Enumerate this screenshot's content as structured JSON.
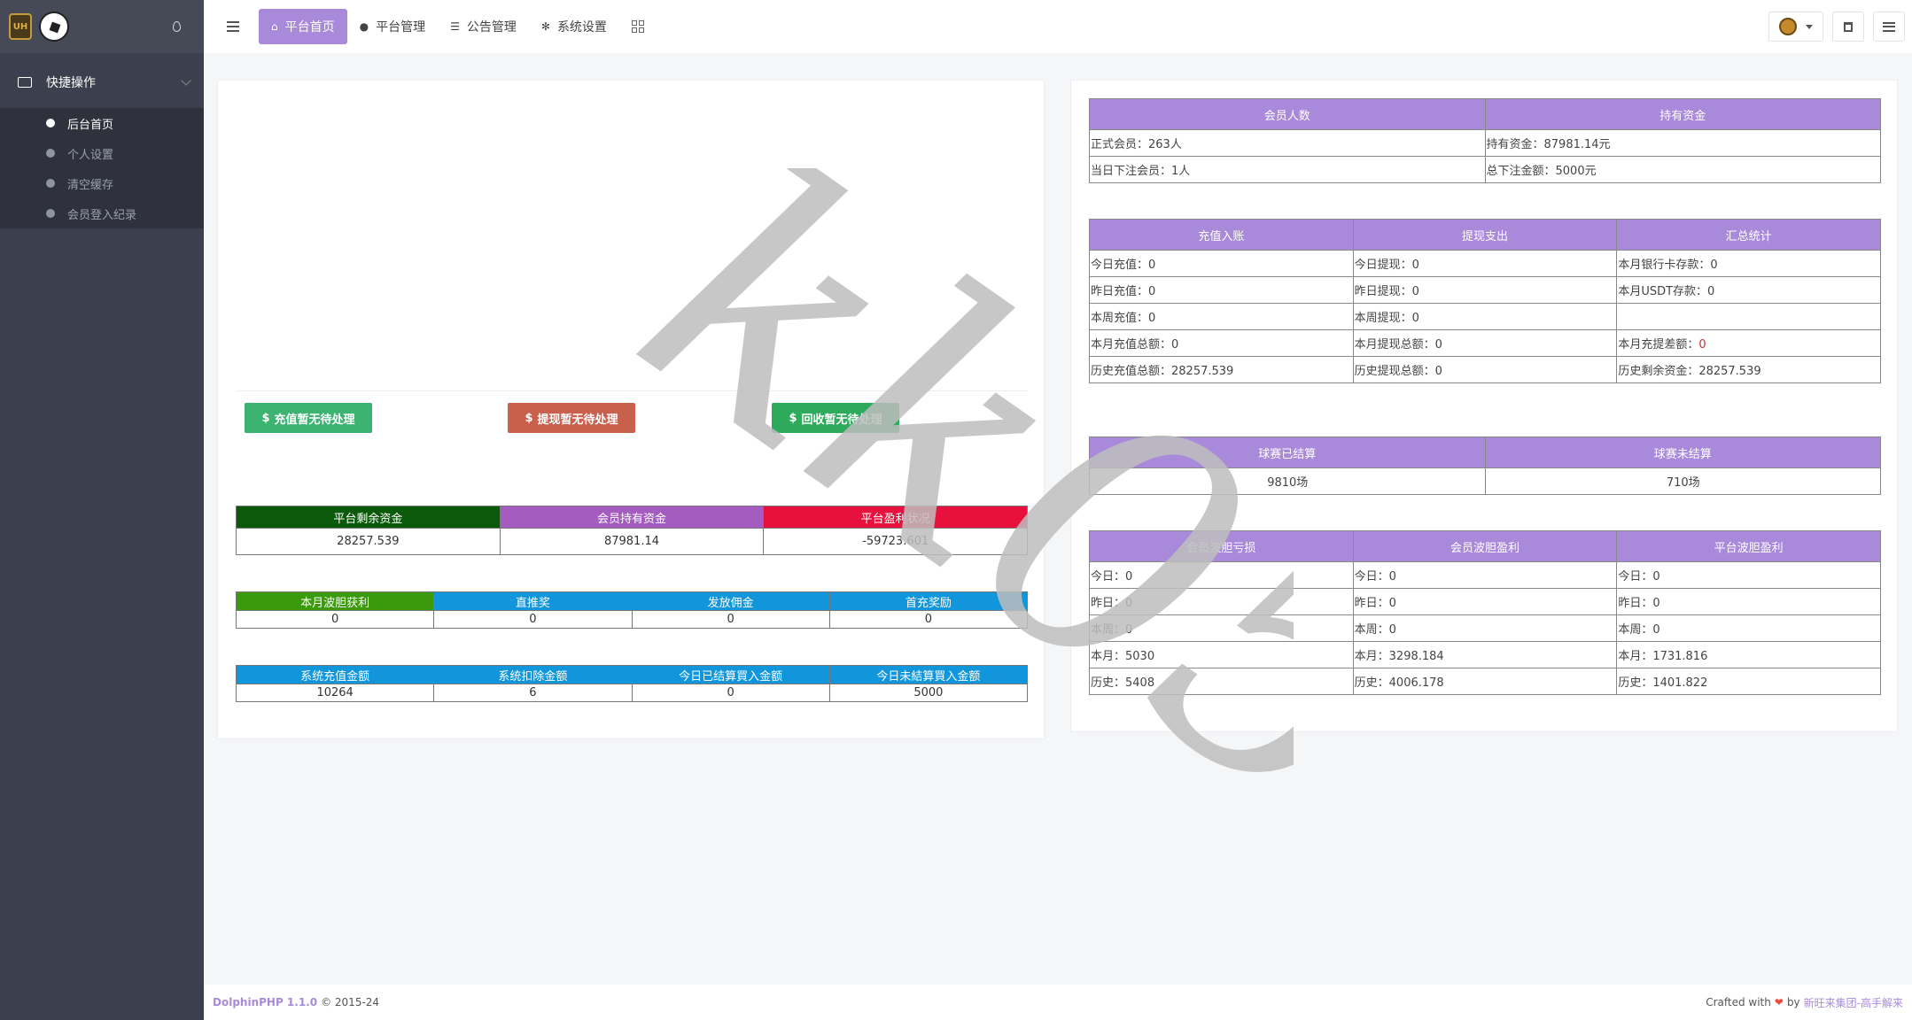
{
  "sidebar": {
    "group_label": "快捷操作",
    "items": [
      {
        "label": "后台首页"
      },
      {
        "label": "个人设置"
      },
      {
        "label": "清空缓存"
      },
      {
        "label": "会员登入纪录"
      }
    ]
  },
  "topbar": {
    "nav": [
      {
        "label": "平台首页",
        "icon": "home-icon"
      },
      {
        "label": "平台管理",
        "icon": "user-icon"
      },
      {
        "label": "公告管理",
        "icon": "list-icon"
      },
      {
        "label": "系统设置",
        "icon": "gear-icon"
      }
    ]
  },
  "left": {
    "buttons": {
      "recharge": "充值暂无待处理",
      "withdraw": "提现暂无待处理",
      "recycle": "回收暂无待处理"
    },
    "summary": {
      "headers": [
        "平台剩余资金",
        "会员持有资金",
        "平台盈利状况"
      ],
      "values": [
        "28257.539",
        "87981.14",
        "-59723.601"
      ]
    },
    "rebate": {
      "headers": [
        "本月波胆获利",
        "直推奖",
        "发放佣金",
        "首充奖励"
      ],
      "values": [
        "0",
        "0",
        "0",
        "0"
      ]
    },
    "system": {
      "headers": [
        "系统充值金额",
        "系统扣除金额",
        "今日已结算買入金额",
        "今日未結算買入金额"
      ],
      "values": [
        "10264",
        "6",
        "0",
        "5000"
      ]
    }
  },
  "right": {
    "members": {
      "headers": [
        "会员人数",
        "持有资金"
      ],
      "rows": [
        [
          "正式会员：263人",
          "持有资金：87981.14元"
        ],
        [
          "当日下注会员：1人",
          "总下注金额：5000元"
        ]
      ]
    },
    "finance": {
      "headers": [
        "充值入账",
        "提现支出",
        "汇总统计"
      ],
      "rows": [
        [
          "今日充值：0",
          "今日提现：0",
          "本月银行卡存款：0"
        ],
        [
          "昨日充值：0",
          "昨日提现：0",
          "本月USDT存款：0"
        ],
        [
          "本周充值：0",
          "本周提现：0",
          ""
        ],
        [
          "本月充值总额：0",
          "本月提现总额：0",
          "本月充提差额："
        ],
        [
          "历史充值总额：28257.539",
          "历史提现总额：0",
          "历史剩余资金：28257.539"
        ]
      ],
      "diff_value": "0"
    },
    "matches": {
      "headers": [
        "球赛已结算",
        "球赛未结算"
      ],
      "values": [
        "9810场",
        "710场"
      ]
    },
    "betting": {
      "headers": [
        "会员波胆亏损",
        "会员波胆盈利",
        "平台波胆盈利"
      ],
      "rows": [
        [
          "今日：0",
          "今日：0",
          "今日：0"
        ],
        [
          "昨日：0",
          "昨日：0",
          "昨日：0"
        ],
        [
          "本周：0",
          "本周：0",
          "本周：0"
        ],
        [
          "本月：5030",
          "本月：3298.184",
          "本月：1731.816"
        ],
        [
          "历史：5408",
          "历史：4006.178",
          "历史：1401.822"
        ]
      ]
    }
  },
  "footer": {
    "brand": "DolphinPHP 1.1.0",
    "copyright": "© 2015-24",
    "crafted": "Crafted with",
    "by": "by",
    "author": "新旺来集团-高手解来"
  },
  "watermark": "kk058",
  "colors": {
    "accent": "#a98ada",
    "sidebar": "#3c3f4d",
    "green_btn": "#3cb371",
    "red_btn": "#c9604d",
    "teal_btn": "#2eaa5c",
    "dark_green": "#0b5a0b",
    "purple": "#a45cc0",
    "crimson": "#e8103c",
    "lime": "#3a9a0c",
    "blue": "#1296db"
  }
}
